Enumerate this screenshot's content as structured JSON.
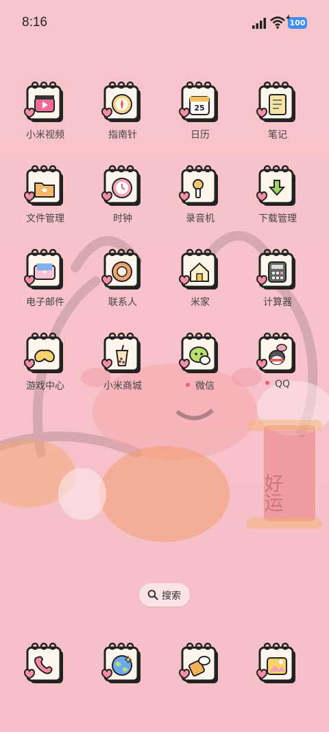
{
  "status_bar": {
    "time": "8:16",
    "battery": "100"
  },
  "apps": [
    {
      "label": "小米视频",
      "icon": "video-icon",
      "dot": false
    },
    {
      "label": "指南针",
      "icon": "compass-icon",
      "dot": false
    },
    {
      "label": "日历",
      "icon": "calendar-icon",
      "dot": false,
      "badge": "25"
    },
    {
      "label": "笔记",
      "icon": "notes-icon",
      "dot": false
    },
    {
      "label": "文件管理",
      "icon": "folder-icon",
      "dot": false
    },
    {
      "label": "时钟",
      "icon": "clock-icon",
      "dot": false
    },
    {
      "label": "录音机",
      "icon": "recorder-icon",
      "dot": false
    },
    {
      "label": "下载管理",
      "icon": "download-icon",
      "dot": false
    },
    {
      "label": "电子邮件",
      "icon": "mail-icon",
      "dot": false
    },
    {
      "label": "联系人",
      "icon": "contacts-icon",
      "dot": false
    },
    {
      "label": "米家",
      "icon": "home-icon",
      "dot": false
    },
    {
      "label": "计算器",
      "icon": "calculator-icon",
      "dot": false
    },
    {
      "label": "游戏中心",
      "icon": "gamepad-icon",
      "dot": false
    },
    {
      "label": "小米商城",
      "icon": "bubble-tea-icon",
      "dot": false
    },
    {
      "label": "微信",
      "icon": "wechat-icon",
      "dot": true
    },
    {
      "label": "QQ",
      "icon": "qq-penguin-icon",
      "dot": true
    }
  ],
  "search": {
    "label": "搜索"
  },
  "dock": [
    {
      "icon": "phone-icon"
    },
    {
      "icon": "browser-globe-icon"
    },
    {
      "icon": "messages-icon"
    },
    {
      "icon": "gallery-icon"
    }
  ],
  "wallpaper_text": "好运",
  "colors": {
    "background": "#f7c2c9",
    "accent": "#3e8df1",
    "dot": "#ef5a7a"
  }
}
